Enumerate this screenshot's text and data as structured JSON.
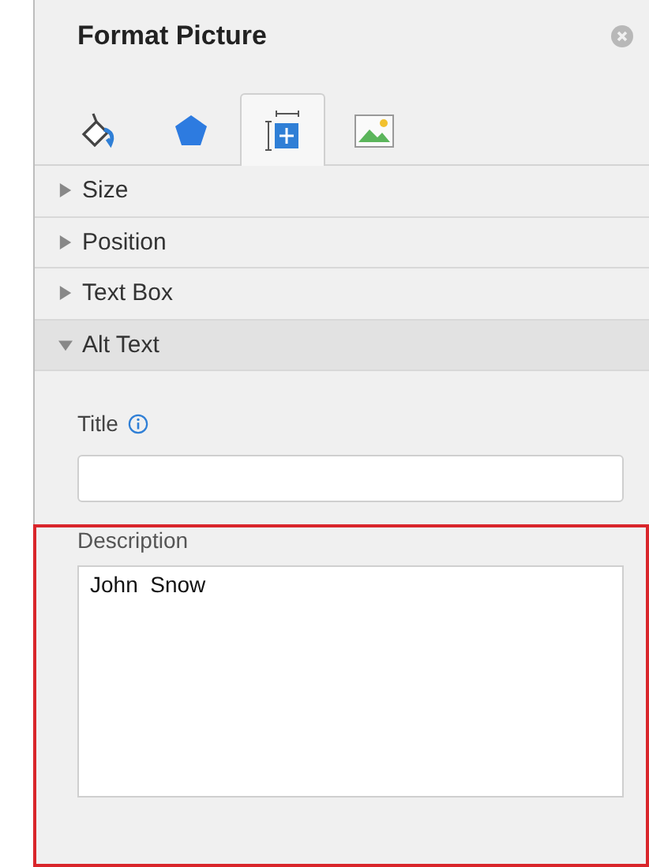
{
  "panel": {
    "title": "Format Picture"
  },
  "tabs": [
    {
      "kind": "fill",
      "selected": false
    },
    {
      "kind": "shape",
      "selected": false
    },
    {
      "kind": "layout",
      "selected": true
    },
    {
      "kind": "picture",
      "selected": false
    }
  ],
  "sections": [
    {
      "label": "Size",
      "expanded": false
    },
    {
      "label": "Position",
      "expanded": false
    },
    {
      "label": "Text Box",
      "expanded": false
    },
    {
      "label": "Alt Text",
      "expanded": true
    }
  ],
  "alt_text": {
    "title_label": "Title",
    "description_label": "Description",
    "description_value": "John  Snow",
    "description_highlighted": true
  }
}
